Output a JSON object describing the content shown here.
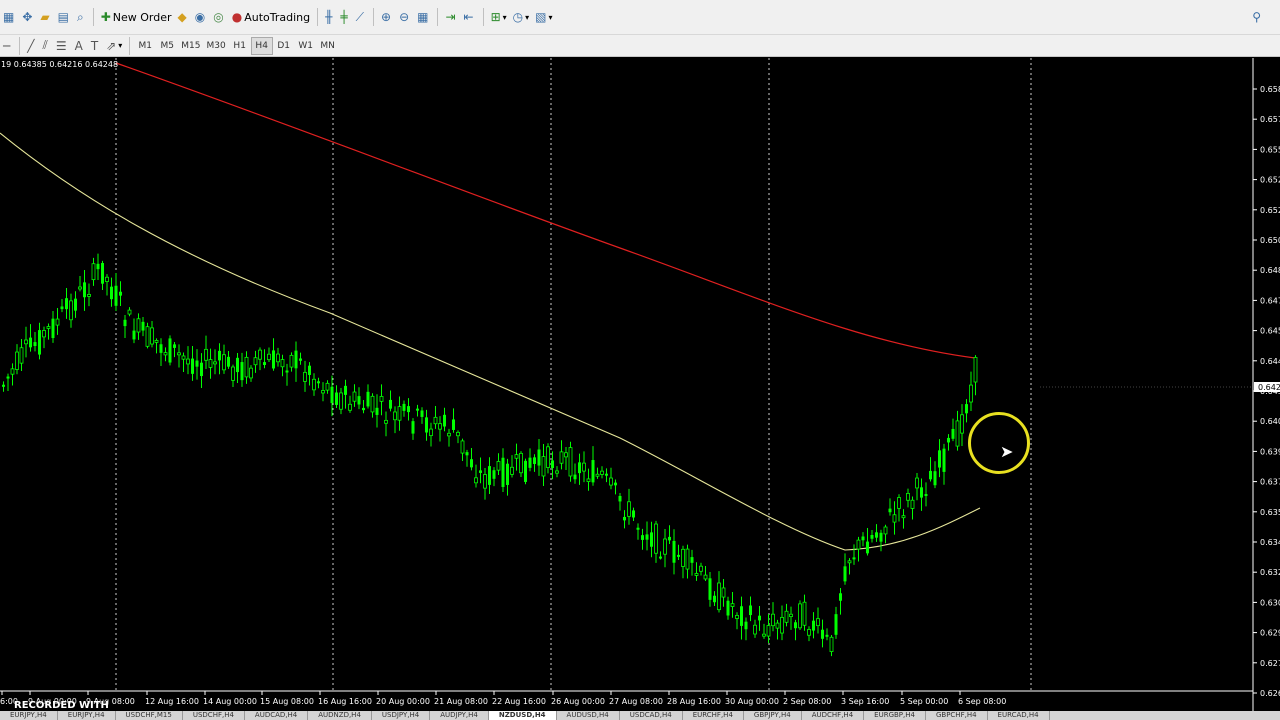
{
  "toolbar": {
    "new_order": "New Order",
    "auto_trading": "AutoTrading",
    "timeframes": [
      "M1",
      "M5",
      "M15",
      "M30",
      "H1",
      "H4",
      "D1",
      "W1",
      "MN"
    ],
    "active_timeframe": "H4"
  },
  "chart": {
    "info_line": "19 0.64385 0.64216 0.64248",
    "price_labels": [
      "0.658",
      "0.657",
      "0.655",
      "0.652",
      "0.652",
      "0.650",
      "0.648",
      "0.647",
      "0.645",
      "0.644",
      "0.643",
      "0.640",
      "0.639",
      "0.637",
      "0.635",
      "0.634",
      "0.632",
      "0.630",
      "0.629",
      "0.627",
      "0.626"
    ],
    "current_price": "0.642",
    "time_labels": [
      "6:00",
      "9 Aug 00:00",
      "9 Aug 08:00",
      "12 Aug 16:00",
      "14 Aug 00:00",
      "15 Aug 08:00",
      "16 Aug 16:00",
      "20 Aug 00:00",
      "21 Aug 08:00",
      "22 Aug 16:00",
      "26 Aug 00:00",
      "27 Aug 08:00",
      "28 Aug 16:00",
      "30 Aug 00:00",
      "2 Sep 08:00",
      "3 Sep 16:00",
      "5 Sep 00:00",
      "6 Sep 08:00"
    ],
    "colors": {
      "bull": "#00ff00",
      "ma_red": "#e02020",
      "ma_yellow": "#e6e69a",
      "grid": "#ffffff"
    }
  },
  "tabs": [
    {
      "label": "EURJPY,H4",
      "active": false
    },
    {
      "label": "EURJPY,H4",
      "active": false
    },
    {
      "label": "USDCHF,M15",
      "active": false
    },
    {
      "label": "USDCHF,H4",
      "active": false
    },
    {
      "label": "AUDCAD,H4",
      "active": false
    },
    {
      "label": "AUDNZD,H4",
      "active": false
    },
    {
      "label": "USDJPY,H4",
      "active": false
    },
    {
      "label": "AUDJPY,H4",
      "active": false
    },
    {
      "label": "NZDUSD,H4",
      "active": true
    },
    {
      "label": "AUDUSD,H4",
      "active": false
    },
    {
      "label": "USDCAD,H4",
      "active": false
    },
    {
      "label": "EURCHF,H4",
      "active": false
    },
    {
      "label": "GBPJPY,H4",
      "active": false
    },
    {
      "label": "AUDCHF,H4",
      "active": false
    },
    {
      "label": "EURGBP,H4",
      "active": false
    },
    {
      "label": "GBPCHF,H4",
      "active": false
    },
    {
      "label": "EURCAD,H4",
      "active": false
    }
  ],
  "watermark": "RECORDED WITH"
}
